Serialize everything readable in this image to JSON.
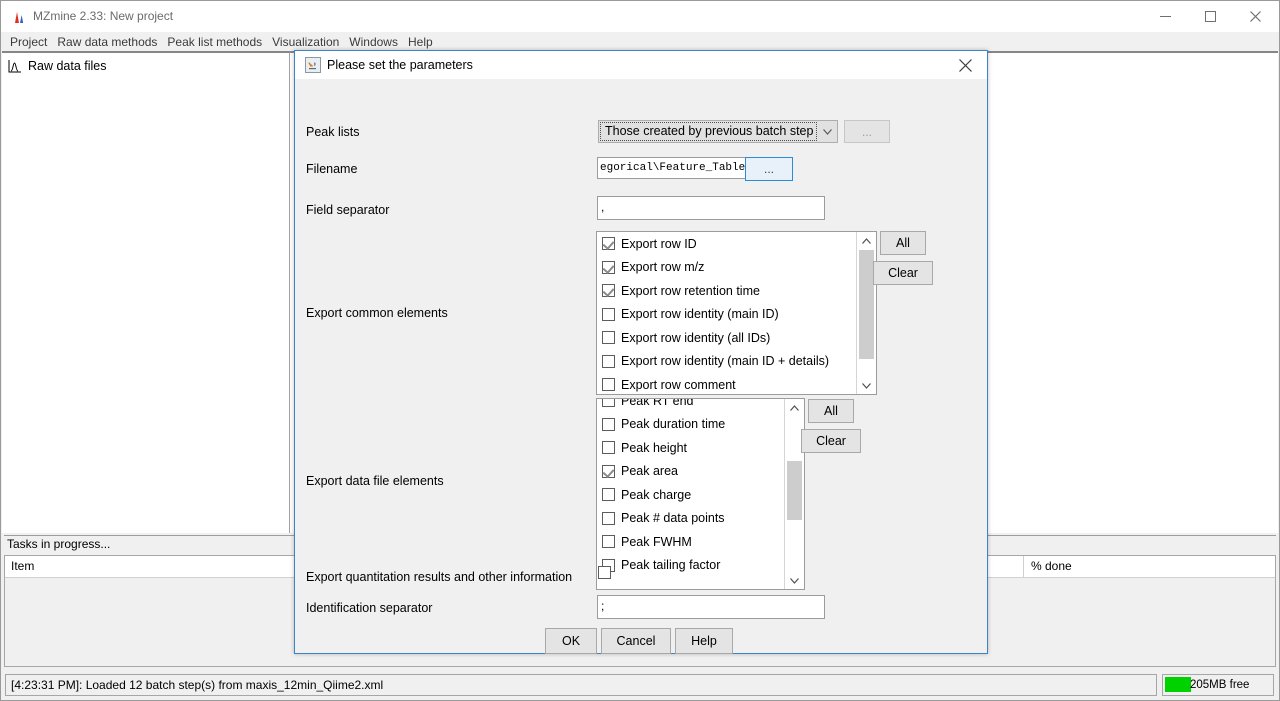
{
  "window": {
    "title": "MZmine 2.33: New project",
    "icon": "mzmine-peaks-icon",
    "controls": {
      "minimize": "minimize-icon",
      "maximize": "maximize-icon",
      "close": "close-icon"
    }
  },
  "menubar": {
    "items": [
      {
        "label": "Project"
      },
      {
        "label": "Raw data methods"
      },
      {
        "label": "Peak list methods"
      },
      {
        "label": "Visualization"
      },
      {
        "label": "Windows"
      },
      {
        "label": "Help"
      }
    ]
  },
  "raw_panel": {
    "header": "Raw data files",
    "icon": "peak-tree-icon"
  },
  "tasks": {
    "title": "Tasks in progress...",
    "columns": [
      "Item",
      "% done"
    ],
    "rows": []
  },
  "statusbar": {
    "message": "[4:23:31 PM]: Loaded 12 batch step(s) from maxis_12min_Qiime2.xml",
    "memory": "205MB free",
    "memory_color": "#00d200"
  },
  "dialog": {
    "title": "Please set the parameters",
    "icon": "java-coffee-icon",
    "close_icon": "close-icon",
    "peak_lists": {
      "label": "Peak lists",
      "value": "Those created by previous batch step",
      "arrow_icon": "chevron-down-icon",
      "browse_label": "..."
    },
    "filename": {
      "label": "Filename",
      "value": "egorical\\Feature_Table_Cat",
      "browse_label": "..."
    },
    "field_separator": {
      "label": "Field separator",
      "value": ","
    },
    "export_common_elements": {
      "label": "Export common elements",
      "all_label": "All",
      "clear_label": "Clear",
      "items": [
        {
          "label": "Export row ID",
          "checked": true
        },
        {
          "label": "Export row m/z",
          "checked": true
        },
        {
          "label": "Export row retention time",
          "checked": true
        },
        {
          "label": "Export row identity (main ID)",
          "checked": false
        },
        {
          "label": "Export row identity (all IDs)",
          "checked": false
        },
        {
          "label": "Export row identity (main ID + details)",
          "checked": false
        },
        {
          "label": "Export row comment",
          "checked": false
        }
      ]
    },
    "export_data_file_elements": {
      "label": "Export data file elements",
      "all_label": "All",
      "clear_label": "Clear",
      "items": [
        {
          "label": "Peak RT end",
          "checked": false
        },
        {
          "label": "Peak duration time",
          "checked": false
        },
        {
          "label": "Peak height",
          "checked": false
        },
        {
          "label": "Peak area",
          "checked": true
        },
        {
          "label": "Peak charge",
          "checked": false
        },
        {
          "label": "Peak # data points",
          "checked": false
        },
        {
          "label": "Peak FWHM",
          "checked": false
        },
        {
          "label": "Peak tailing factor",
          "checked": false
        }
      ]
    },
    "export_quantitation": {
      "label": "Export quantitation results and other information",
      "checked": false
    },
    "identification_separator": {
      "label": "Identification separator",
      "value": ";"
    },
    "buttons": {
      "ok": "OK",
      "cancel": "Cancel",
      "help": "Help"
    }
  }
}
